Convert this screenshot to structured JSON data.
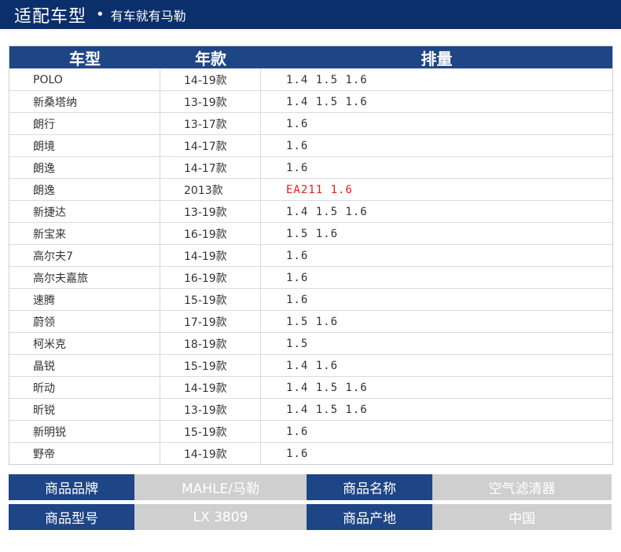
{
  "header": {
    "title": "适配车型",
    "bullet": "•",
    "subtitle": "有车就有马勒"
  },
  "table": {
    "columns": [
      "车型",
      "年款",
      "排量"
    ],
    "rows": [
      {
        "model": "POLO",
        "year": "14-19款",
        "disp": "1.4 1.5 1.6"
      },
      {
        "model": "新桑塔纳",
        "year": "13-19款",
        "disp": "1.4 1.5 1.6"
      },
      {
        "model": "朗行",
        "year": "13-17款",
        "disp": "1.6"
      },
      {
        "model": "朗境",
        "year": "14-17款",
        "disp": "1.6"
      },
      {
        "model": "朗逸",
        "year": "14-17款",
        "disp": "1.6"
      },
      {
        "model": "朗逸",
        "year": "2013款",
        "disp": "EA211 1.6",
        "highlight": true
      },
      {
        "model": "新捷达",
        "year": "13-19款",
        "disp": "1.4 1.5 1.6"
      },
      {
        "model": "新宝来",
        "year": "16-19款",
        "disp": "1.5 1.6"
      },
      {
        "model": "高尔夫7",
        "year": "14-19款",
        "disp": "1.6"
      },
      {
        "model": "高尔夫嘉旅",
        "year": "16-19款",
        "disp": "1.6"
      },
      {
        "model": "速腾",
        "year": "15-19款",
        "disp": "1.6"
      },
      {
        "model": "蔚领",
        "year": "17-19款",
        "disp": "1.5 1.6"
      },
      {
        "model": "柯米克",
        "year": "18-19款",
        "disp": "1.5"
      },
      {
        "model": "晶锐",
        "year": "15-19款",
        "disp": "1.4 1.6"
      },
      {
        "model": "昕动",
        "year": "14-19款",
        "disp": "1.4 1.5 1.6"
      },
      {
        "model": "昕锐",
        "year": "13-19款",
        "disp": "1.4 1.5 1.6"
      },
      {
        "model": "新明锐",
        "year": "15-19款",
        "disp": "1.6"
      },
      {
        "model": "野帝",
        "year": "14-19款",
        "disp": "1.6"
      }
    ],
    "highlight_color": "#e0201a"
  },
  "specs": [
    {
      "label1": "商品品牌",
      "value1": "MAHLE/马勒",
      "label2": "商品名称",
      "value2": "空气滤清器"
    },
    {
      "label1": "商品型号",
      "value1": "LX 3809",
      "label2": "商品产地",
      "value2": "中国"
    }
  ],
  "colors": {
    "banner": "#0b2f6a",
    "header_blue": "#1e4585",
    "value_gray": "#cfcfcf"
  }
}
